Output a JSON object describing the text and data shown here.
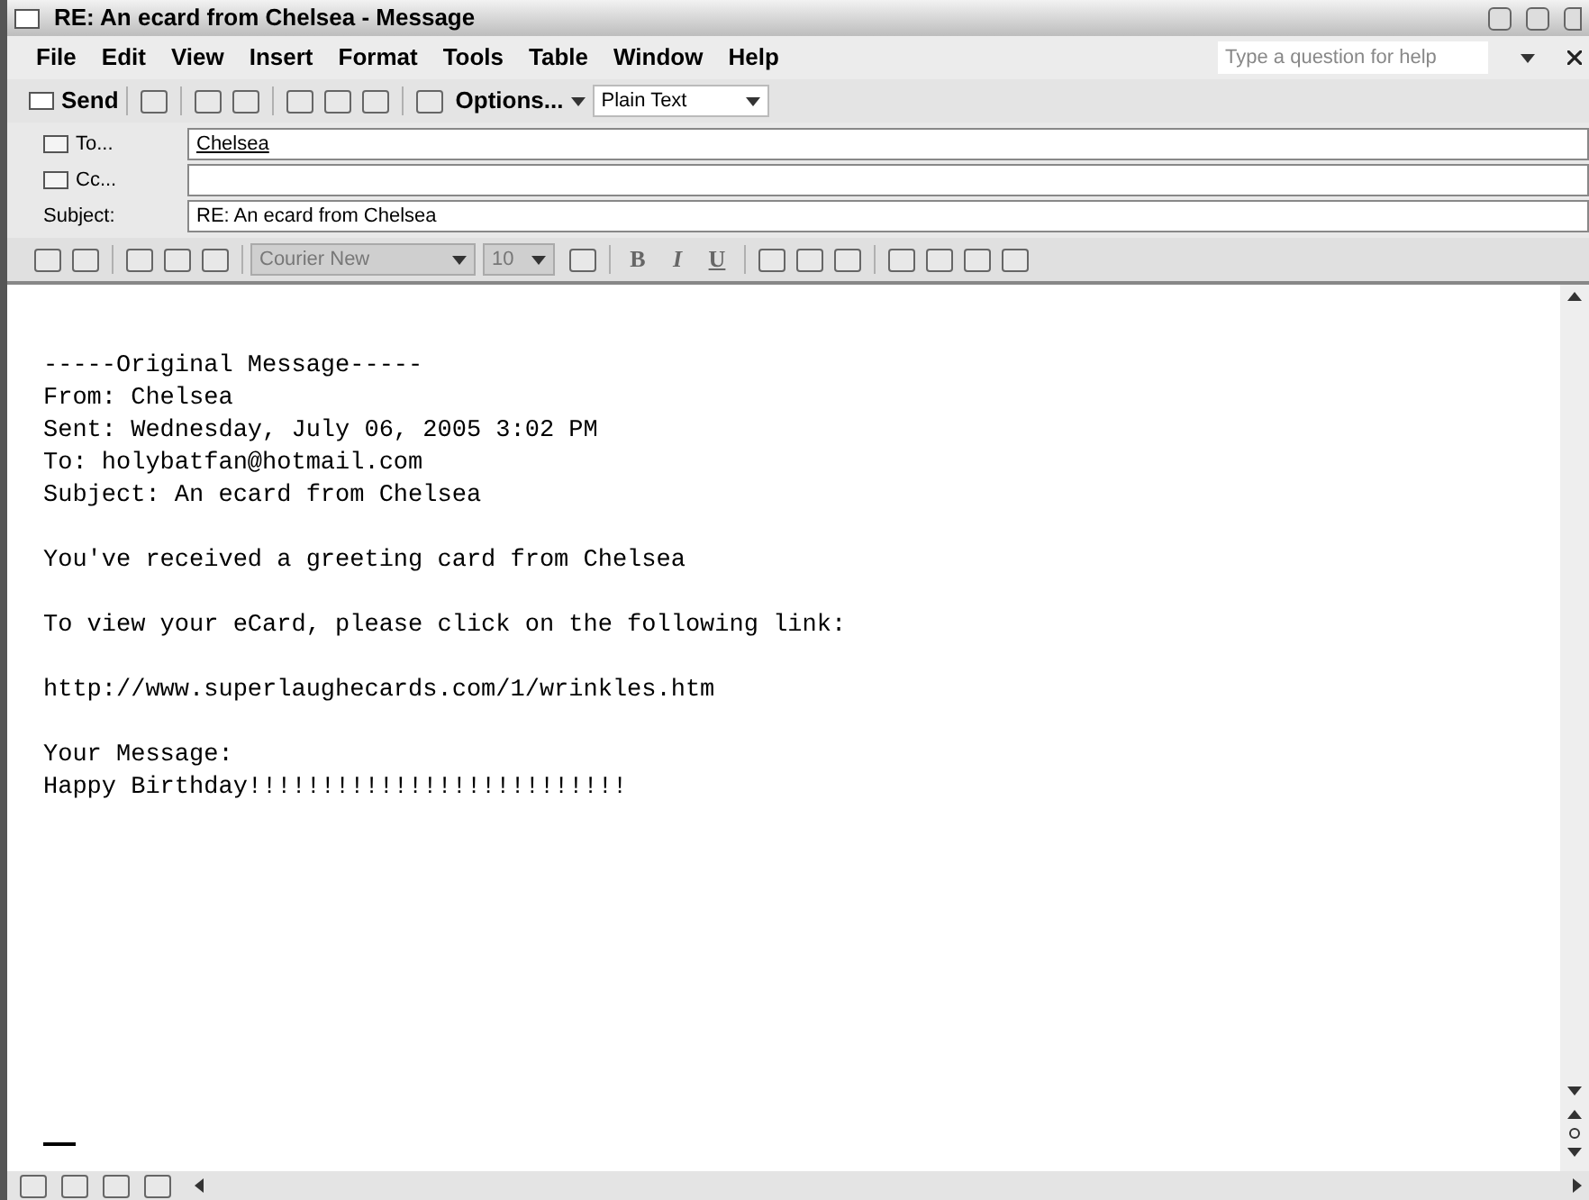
{
  "window": {
    "title": "RE: An ecard from Chelsea - Message"
  },
  "menu": [
    "File",
    "Edit",
    "View",
    "Insert",
    "Format",
    "Tools",
    "Table",
    "Window",
    "Help"
  ],
  "help_search": {
    "placeholder": "Type a question for help"
  },
  "toolbar": {
    "send": "Send",
    "options": "Options...",
    "format": "Plain Text"
  },
  "header_fields": [
    {
      "label": "To...",
      "kind": "address",
      "value": "Chelsea"
    },
    {
      "label": "Cc...",
      "kind": "address"
    },
    {
      "label": "Subject:",
      "kind": "plain",
      "value": "RE: An ecard from Chelsea"
    }
  ],
  "format_toolbar": {
    "font": "Courier New",
    "size": "10",
    "buttons": [
      "B",
      "I",
      "U"
    ]
  },
  "body": {
    "paragraphs": [
      [
        "-----Original Message-----",
        "From: Chelsea",
        "Sent: Wednesday, July 06, 2005 3:02 PM",
        "To: holybatfan@hotmail.com",
        "Subject: An ecard from Chelsea"
      ],
      [
        "You've received a greeting card from Chelsea"
      ],
      [
        "To view your eCard, please click on the following link:"
      ],
      [
        "http://www.superlaughecards.com/1/wrinkles.htm"
      ],
      [
        "Your Message:",
        "Happy Birthday!!!!!!!!!!!!!!!!!!!!!!!!!!"
      ]
    ]
  }
}
